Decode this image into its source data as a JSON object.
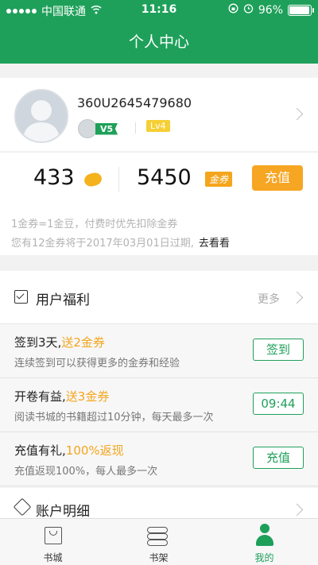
{
  "statusbar": {
    "carrier": "中国联通",
    "time": "11:16",
    "battery": "96%",
    "battery_level": 0.96
  },
  "navbar": {
    "title": "个人中心"
  },
  "profile": {
    "username": "360U2645479680",
    "vip_level": "V5",
    "user_level": "Lv4"
  },
  "balance": {
    "beans": "433",
    "coupons": "5450",
    "coupon_tag": "金券",
    "recharge_label": "充值"
  },
  "notes": {
    "line1": "1金券=1金豆，付费时优先扣除金券",
    "line2": "您有12金券将于2017年03月01日过期,",
    "link": "去看看"
  },
  "benefits": {
    "title": "用户福利",
    "more": "更多",
    "items": [
      {
        "title": "签到3天,",
        "highlight": "送2金券",
        "desc": "连续签到可以获得更多的金券和经验",
        "button": "签到"
      },
      {
        "title": "开卷有益,",
        "highlight": "送3金券",
        "desc": "阅读书城的书籍超过10分钟，每天最多一次",
        "button": "09:44"
      },
      {
        "title": "充值有礼,",
        "highlight": "100%返现",
        "desc": "充值返现100%，每人最多一次",
        "button": "充值"
      }
    ]
  },
  "account": {
    "title": "账户明细"
  },
  "tabs": [
    {
      "label": "书城",
      "icon": "bag-icon"
    },
    {
      "label": "书架",
      "icon": "shelf-icon"
    },
    {
      "label": "我的",
      "icon": "person-icon"
    }
  ],
  "colors": {
    "brand": "#1ea05a",
    "accent": "#f6a623",
    "highlight": "#f4a51c"
  }
}
